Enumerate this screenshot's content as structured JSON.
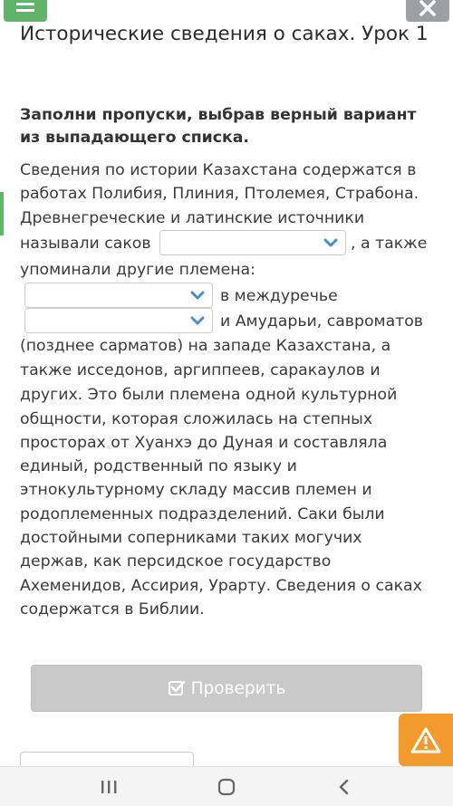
{
  "header": {
    "menu_icon": "menu-icon",
    "close_icon": "close-icon"
  },
  "lesson": {
    "title": "Исторические сведения о саках. Урок 1",
    "instruction": "Заполни пропуски, выбрав верный вариант из выпадающего списка."
  },
  "text": {
    "line1": "Сведения по истории Казахстана содержатся в",
    "line2": "работах Полибия, Плиния, Птолемея, Страбона.",
    "line3": "Древнегреческие и латинские источники",
    "line4a": "называли саков",
    "line4b": ", а также",
    "line5": "упоминали другие племена:",
    "line6b": "в междуречье",
    "line7b": "и Амударьи, савроматов",
    "line8": "(позднее сарматов) на западе Казахстана, а",
    "line9": "также исседонов, аргиппеев, саракаулов и",
    "line10": "других. Это были племена одной культурной",
    "line11": "общности, которая сложилась на степных",
    "line12": "просторах от Хуанхэ до Дуная и составляла",
    "line13": "единый, родственный по языку и",
    "line14": "этнокультурному складу массив племен и",
    "line15": "родоплеменных подразделений. Саки были",
    "line16": "достойными соперниками таких могучих",
    "line17": "держав, как персидское государство",
    "line18": "Ахеменидов, Ассирия, Урарту. Сведения о саках",
    "line19": "содержатся в Библии."
  },
  "dropdowns": {
    "d1": {
      "selected": ""
    },
    "d2": {
      "selected": ""
    },
    "d3": {
      "selected": ""
    }
  },
  "actions": {
    "check_label": "Проверить",
    "warning_icon": "warning-icon"
  },
  "colors": {
    "menu_green": "#62b36a",
    "close_gray": "#9aa0a6",
    "check_disabled": "#c9c9c9",
    "warning_orange": "#f39a2f",
    "chevron_blue": "#4a90c8"
  }
}
